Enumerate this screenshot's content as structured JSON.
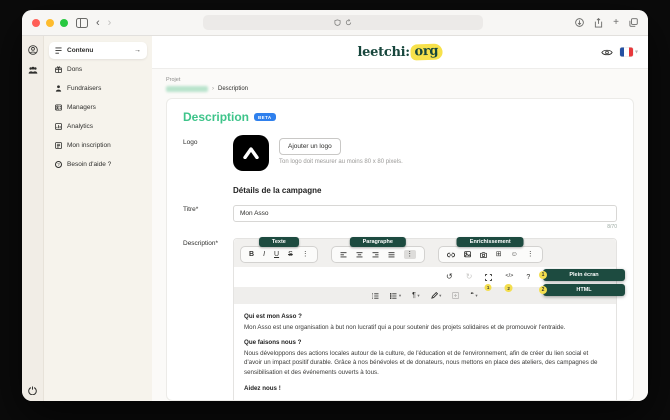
{
  "colors": {
    "accent_dark_green": "#1d4b40",
    "title_green": "#3ec48a",
    "annotation_yellow": "#f3de4e",
    "badge_blue": "#2f80ed",
    "logo_highlight_yellow": "#f7e14b",
    "sidebar_cream": "#f6f3ec"
  },
  "header": {
    "logo_left": "leetchi:",
    "logo_right": "org"
  },
  "sidebar": {
    "items": [
      {
        "label": "Contenu",
        "arrow": "→"
      },
      {
        "label": "Dons"
      },
      {
        "label": "Fundraisers"
      },
      {
        "label": "Managers"
      },
      {
        "label": "Analytics"
      },
      {
        "label": "Mon inscription"
      },
      {
        "label": "Besoin d'aide ?"
      }
    ]
  },
  "breadcrumb": {
    "eyebrow": "Projet",
    "separator": "›",
    "current": "Description"
  },
  "page": {
    "title": "Description",
    "badge": "BETA"
  },
  "logo_section": {
    "label": "Logo",
    "button": "Ajouter un logo",
    "hint": "Ton logo doit mesurer au moins 80 x 80 pixels."
  },
  "details": {
    "heading": "Détails de la campagne",
    "title_label": "Titre*",
    "title_value": "Mon Asso",
    "counter": "8/70",
    "description_label": "Description*"
  },
  "editor": {
    "groups": [
      {
        "label": "Texte"
      },
      {
        "label": "Paragraphe"
      },
      {
        "label": "Enrichissement"
      }
    ],
    "annotations": [
      {
        "num": "1",
        "label": "Plein écran"
      },
      {
        "num": "2",
        "label": "HTML"
      }
    ],
    "icons": {
      "bold": "B",
      "italic": "I",
      "underline": "U",
      "strike": "S",
      "more": "⋮",
      "undo": "↺",
      "redo": "↻",
      "code": "</>",
      "help": "?",
      "paragraph": "¶",
      "quote": "“",
      "caret": "▾",
      "table": "⊞",
      "emoji": "☺"
    },
    "content": [
      {
        "type": "h",
        "text": "Qui est mon Asso ?"
      },
      {
        "type": "p",
        "text": "Mon Asso est une organisation à but non lucratif qui a pour soutenir des projets solidaires et de promouvoir l'entraide."
      },
      {
        "type": "h",
        "text": "Que faisons nous ?"
      },
      {
        "type": "p",
        "text": "Nous développons des actions locales autour de la culture, de l'éducation et de l'environnement, afin de créer du lien social et d'avoir un impact positif durable. Grâce à nos bénévoles et de donateurs, nous mettons en place des ateliers, des campagnes de sensibilisation et des événements ouverts à tous."
      },
      {
        "type": "h",
        "text": "Aidez nous !"
      }
    ]
  }
}
